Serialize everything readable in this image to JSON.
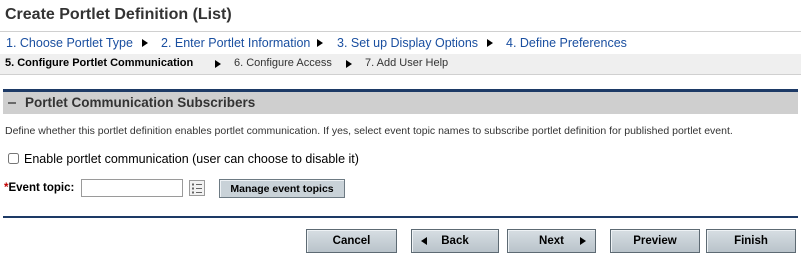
{
  "page": {
    "title": "Create Portlet Definition (List)"
  },
  "wizard": {
    "row1": [
      {
        "label": "1. Choose Portlet Type"
      },
      {
        "label": "2. Enter Portlet Information"
      },
      {
        "label": "3. Set up Display Options"
      },
      {
        "label": "4. Define Preferences"
      }
    ],
    "row2": [
      {
        "label": "5. Configure Portlet Communication",
        "current": true
      },
      {
        "label": "6. Configure Access"
      },
      {
        "label": "7. Add User Help"
      }
    ]
  },
  "section": {
    "title": "Portlet Communication Subscribers",
    "description": "Define whether this portlet definition enables portlet communication. If yes, select event topic names to subscribe portlet definition for published portlet event.",
    "enable_checkbox": {
      "label": "Enable portlet communication (user can choose to disable it)",
      "checked": false
    },
    "event_topic": {
      "required_mark": "*",
      "label": "Event topic:",
      "value": "",
      "picker_icon": "list-picker-icon"
    },
    "manage_button": "Manage event topics"
  },
  "footer": {
    "cancel": "Cancel",
    "back": "Back",
    "next": "Next",
    "preview": "Preview",
    "finish": "Finish"
  },
  "colors": {
    "section_rule": "#1d3a66",
    "section_header_bg": "#cfcfcf",
    "wizard_link": "#1a4fa0",
    "required": "#c00000"
  }
}
